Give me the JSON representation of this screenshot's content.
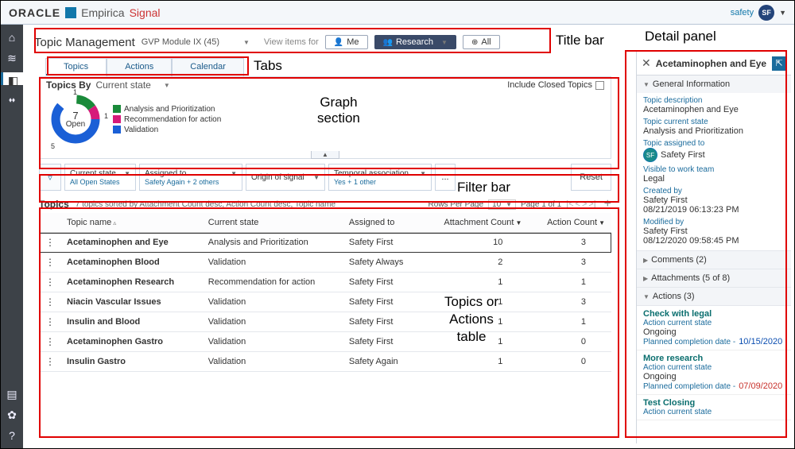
{
  "brand": {
    "t1": "ORACLE",
    "t2": "Empirica",
    "t3": "Signal",
    "user_label": "safety",
    "user_initials": "SF"
  },
  "annotations": {
    "titlebar": "Title bar",
    "detail": "Detail panel",
    "tabs": "Tabs",
    "graph1": "Graph",
    "graph2": "section",
    "filterbar": "Filter bar",
    "table1": "Topics or",
    "table2": "Actions",
    "table3": "table"
  },
  "titlebar": {
    "heading": "Topic Management",
    "module": "GVP Module IX (45)",
    "view_items_for": "View items for",
    "me": "Me",
    "research": "Research",
    "all": "All"
  },
  "tabs": {
    "topics": "Topics",
    "actions": "Actions",
    "calendar": "Calendar"
  },
  "graph": {
    "by_label": "Topics By",
    "by_value": "Current state",
    "include_closed": "Include Closed Topics",
    "center_num": "7",
    "center_label": "Open",
    "seg_top": "1",
    "seg_right": "1",
    "seg_bottom": "5",
    "legend": [
      {
        "color": "#1a8a3a",
        "label": "Analysis and Prioritization"
      },
      {
        "color": "#d61a7a",
        "label": "Recommendation for action"
      },
      {
        "color": "#1a5fd6",
        "label": "Validation"
      }
    ]
  },
  "filters": [
    {
      "label": "Current state",
      "sub": "All Open States"
    },
    {
      "label": "Assigned to",
      "sub": "Safety Again + 2 others"
    },
    {
      "label": "Origin of signal",
      "sub": ""
    },
    {
      "label": "Temporal association",
      "sub": "Yes + 1 other"
    }
  ],
  "filter_more": "...",
  "reset": "Reset",
  "table": {
    "title": "Topics",
    "summary": "7 topics sorted by Attachment Count desc, Action Count desc, Topic name",
    "rpp_label": "Rows Per Page",
    "rpp_value": "10",
    "page_label": "Page 1 of 1",
    "cols": {
      "name": "Topic name",
      "state": "Current state",
      "assigned": "Assigned to",
      "attach": "Attachment Count",
      "actions": "Action Count"
    },
    "rows": [
      {
        "name": "Acetaminophen and Eye",
        "state": "Analysis and Prioritization",
        "assigned": "Safety First",
        "attach": "10",
        "actions": "3",
        "selected": true
      },
      {
        "name": "Acetaminophen Blood",
        "state": "Validation",
        "assigned": "Safety Always",
        "attach": "2",
        "actions": "3"
      },
      {
        "name": "Acetaminophen Research",
        "state": "Recommendation for action",
        "assigned": "Safety First",
        "attach": "1",
        "actions": "1"
      },
      {
        "name": "Niacin Vascular Issues",
        "state": "Validation",
        "assigned": "Safety First",
        "attach": "1",
        "actions": "3"
      },
      {
        "name": "Insulin and Blood",
        "state": "Validation",
        "assigned": "Safety First",
        "attach": "1",
        "actions": "1"
      },
      {
        "name": "Acetaminophen Gastro",
        "state": "Validation",
        "assigned": "Safety First",
        "attach": "1",
        "actions": "0"
      },
      {
        "name": "Insulin Gastro",
        "state": "Validation",
        "assigned": "Safety Again",
        "attach": "1",
        "actions": "0"
      }
    ]
  },
  "detail": {
    "title": "Acetaminophen and Eye",
    "gi_header": "General Information",
    "desc_k": "Topic description",
    "desc_v": "Acetaminophen and Eye",
    "state_k": "Topic current state",
    "state_v": "Analysis and Prioritization",
    "assigned_k": "Topic assigned to",
    "assigned_v": "Safety First",
    "assigned_initials": "SF",
    "visible_k": "Visible to work team",
    "visible_v": "Legal",
    "created_k": "Created by",
    "created_by": "Safety First",
    "created_at": "08/21/2019 06:13:23 PM",
    "modified_k": "Modified by",
    "modified_by": "Safety First",
    "modified_at": "08/12/2020 09:58:45 PM",
    "comments_h": "Comments (2)",
    "attachments_h": "Attachments (5 of 8)",
    "actions_h": "Actions (3)",
    "actions": [
      {
        "name": "Check with legal",
        "state_k": "Action current state",
        "state_v": "Ongoing",
        "pcd_k": "Planned completion date -",
        "pcd_v": "10/15/2020",
        "pcd_cls": "dt-blue"
      },
      {
        "name": "More research",
        "state_k": "Action current state",
        "state_v": "Ongoing",
        "pcd_k": "Planned completion date -",
        "pcd_v": "07/09/2020",
        "pcd_cls": "dt-red"
      },
      {
        "name": "Test Closing",
        "state_k": "Action current state",
        "state_v": ""
      }
    ]
  },
  "chart_data": {
    "type": "pie",
    "title": "Topics By Current state",
    "categories": [
      "Analysis and Prioritization",
      "Recommendation for action",
      "Validation"
    ],
    "values": [
      1,
      1,
      5
    ],
    "total_label": "Open",
    "total": 7,
    "colors": [
      "#1a8a3a",
      "#d61a7a",
      "#1a5fd6"
    ]
  }
}
